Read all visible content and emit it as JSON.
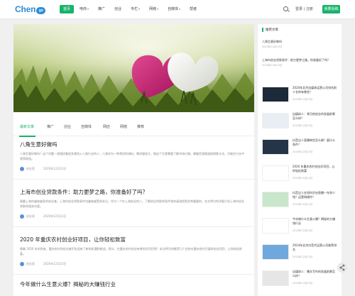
{
  "brand": {
    "logo_main": "Chen",
    "logo_tail": "go"
  },
  "nav": [
    {
      "label": "首页",
      "active": true,
      "dropdown": false
    },
    {
      "label": "电商",
      "active": false,
      "dropdown": true
    },
    {
      "label": "推广",
      "active": false,
      "dropdown": false
    },
    {
      "label": "创业",
      "active": false,
      "dropdown": false
    },
    {
      "label": "专栏",
      "active": false,
      "dropdown": true
    },
    {
      "label": "网络",
      "active": false,
      "dropdown": true
    },
    {
      "label": "自媒体",
      "active": false,
      "dropdown": true
    },
    {
      "label": "帮者",
      "active": false,
      "dropdown": false
    }
  ],
  "header": {
    "login_text": "登录 | 注册",
    "post_label": "我要投稿"
  },
  "tabs": [
    "最新文章",
    "推广",
    "创业",
    "自媒体",
    "网店",
    "网络",
    "推荐"
  ],
  "articles": [
    {
      "title": "八角生意好做吗",
      "excerpt": "八角生意好做吗？这个问题一直困扰着很多想进入八角行业的人，八角作为一种常用的调料，需求量较大，做这个生意需要了解市场行情，掌握货源渠道和销售方法，才能在行业中获得收益。",
      "author": "创业家",
      "date": "2020年12月23日"
    },
    {
      "title": "上海市创业贷款条件：助力更梦之路，你准备好了吗？",
      "excerpt": "随着上海市越来越多的创业者，上海市创业贷款条件也越来越受到关注，作为一个在上海创业的人，了解创业贷款的条件和申请流程是非常重要的，本文将为你详细介绍上海市创业贷款的相关内容。",
      "author": "创业家",
      "date": "2020年12月23日"
    },
    {
      "title": "2020 年重庆农村创业好项目，让你轻松致富",
      "excerpt": "随着 2020 年的到来，重庆农村的创业者们也迎来了新的机遇和挑战，那么，在重庆农村创业有哪些好项目呢？本文将为你推荐几个适合在重庆农村开展的创业项目，让你轻松致富。",
      "author": "创业家",
      "date": "2020年12月23日"
    },
    {
      "title": "今年做什么生意火爆？揭秘的大赚钱行业",
      "excerpt": "",
      "author": "",
      "date": ""
    }
  ],
  "sidebar": {
    "title": "推荐文章",
    "items": [
      {
        "text": "八角生意好做吗",
        "date": "2020年12月23日"
      },
      {
        "text": "上海市创业贷款条件：助力更梦之路，你准备好了吗？",
        "date": "2020年12月23日"
      }
    ],
    "thumbs": [
      {
        "text": "2024年北京自媒体运营公司排名前十名的有哪些？",
        "date": "2020年12月23日",
        "bg": "#1c2a3a"
      },
      {
        "text": "自媒体人：常月热创业的发展前景怎么样？",
        "date": "2020年12月23日",
        "bg": "#e9eef5"
      },
      {
        "text": "抖音达人直播带货怎么做？要什么条件？",
        "date": "2020年12月23日",
        "bg": "#253447"
      },
      {
        "text": "2020 年重庆农村创业好项目，让你轻松致富",
        "date": "2020年12月23日",
        "bg": "#ffffff"
      },
      {
        "text": "抖音达人在如何开启直播一年多少钱？运营和操作？",
        "date": "2020年12月23日",
        "bg": "#c8e6c9"
      },
      {
        "text": "今年做什么生意火爆？揭秘的大赚钱行业",
        "date": "2020年12月23日",
        "bg": "#ffffff"
      },
      {
        "text": "2024年北京抖音代运营公司推荐排名",
        "date": "2020年12月23日",
        "bg": "#6fa8dc"
      },
      {
        "text": "自媒体人：爆文写作的发展前景怎么样？",
        "date": "2020年12月23日",
        "bg": "#e6e6e6"
      }
    ]
  }
}
